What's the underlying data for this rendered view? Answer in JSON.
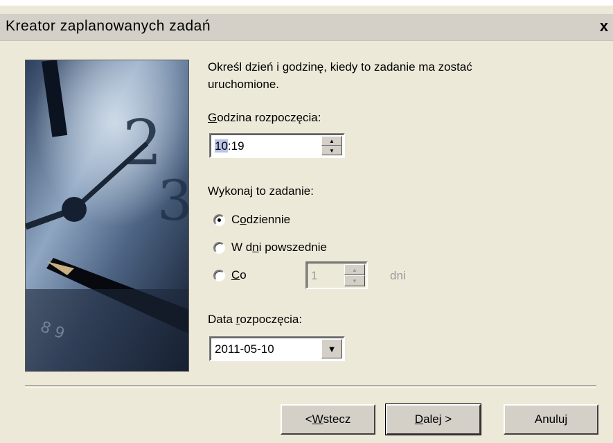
{
  "window": {
    "title": "Kreator zaplanowanych zadań",
    "close_symbol": "x"
  },
  "intro": {
    "line1": "Określ dzień i godzinę, kiedy to zadanie ma zostać",
    "line2": "uruchomione."
  },
  "start_time": {
    "label_accel": "G",
    "label_rest": "odzina rozpoczęcia:",
    "value_hour": "10",
    "value_rest": ":19"
  },
  "frequency": {
    "label": "Wykonaj to zadanie:",
    "options": [
      {
        "pre": "C",
        "accel": "o",
        "post": "dziennie",
        "checked": true
      },
      {
        "pre": "W d",
        "accel": "n",
        "post": "i powszednie",
        "checked": false
      },
      {
        "pre": "",
        "accel": "C",
        "post": "o",
        "checked": false
      }
    ],
    "every_value": "1",
    "every_unit": "dni"
  },
  "start_date": {
    "label_pre": "Data ",
    "label_accel": "r",
    "label_post": "ozpoczęcia:",
    "value": "2011-05-10"
  },
  "buttons": {
    "back_pre": "< ",
    "back_accel": "W",
    "back_post": "stecz",
    "next_accel": "D",
    "next_post": "alej >",
    "cancel": "Anuluj"
  },
  "icons": {
    "banner": "clock-and-pen-illustration",
    "spin": "spin-up-down-icon",
    "combo": "dropdown-arrow-icon"
  }
}
